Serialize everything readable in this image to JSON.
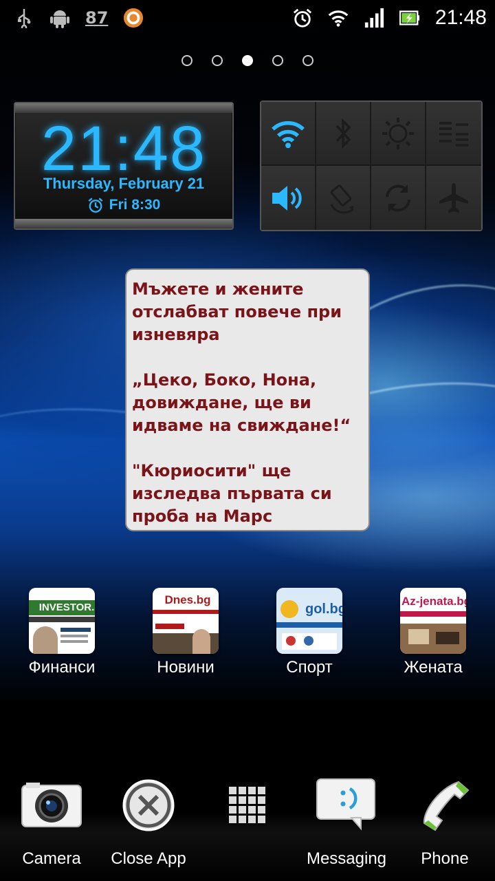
{
  "status_bar": {
    "left_icons": [
      "usb-icon",
      "android-icon",
      "badge-87",
      "app-circle-icon"
    ],
    "badge_number": "87",
    "right_icons": [
      "alarm-clock-icon",
      "wifi-icon",
      "signal-icon",
      "battery-charging-icon"
    ],
    "time": "21:48"
  },
  "page_indicator": {
    "total": 5,
    "active_index": 2
  },
  "clock_widget": {
    "time": "21:48",
    "date": "Thursday, February 21",
    "alarm": "Fri 8:30",
    "color": "#2bb8ff"
  },
  "toggle_widget": {
    "items": [
      {
        "name": "wifi-icon",
        "active": true
      },
      {
        "name": "bluetooth-icon",
        "active": false
      },
      {
        "name": "brightness-icon",
        "active": false
      },
      {
        "name": "data-sync-icon",
        "active": false
      },
      {
        "name": "volume-icon",
        "active": true
      },
      {
        "name": "rotate-icon",
        "active": false
      },
      {
        "name": "sync-icon",
        "active": false
      },
      {
        "name": "airplane-icon",
        "active": false
      }
    ],
    "active_color": "#2bb8ff"
  },
  "news_widget": {
    "headlines": [
      "Мъжете и жените отслабват повече при изневяра",
      "„Цеко, Боко, Нона, довиждане, ще ви идваме на свиждане!“",
      "\"Кюриосити\" ще изследва първата си проба на Марс"
    ],
    "text_color": "#7a1419"
  },
  "apps": [
    {
      "label": "Финанси",
      "site": "INVESTOR."
    },
    {
      "label": "Новини",
      "site": "Dnes.bg"
    },
    {
      "label": "Спорт",
      "site": "gol.bg"
    },
    {
      "label": "Жената",
      "site": "Az-jenata.bg"
    }
  ],
  "dock": [
    {
      "label": "Camera"
    },
    {
      "label": "Close App"
    },
    {
      "label": ""
    },
    {
      "label": "Messaging"
    },
    {
      "label": "Phone"
    }
  ]
}
